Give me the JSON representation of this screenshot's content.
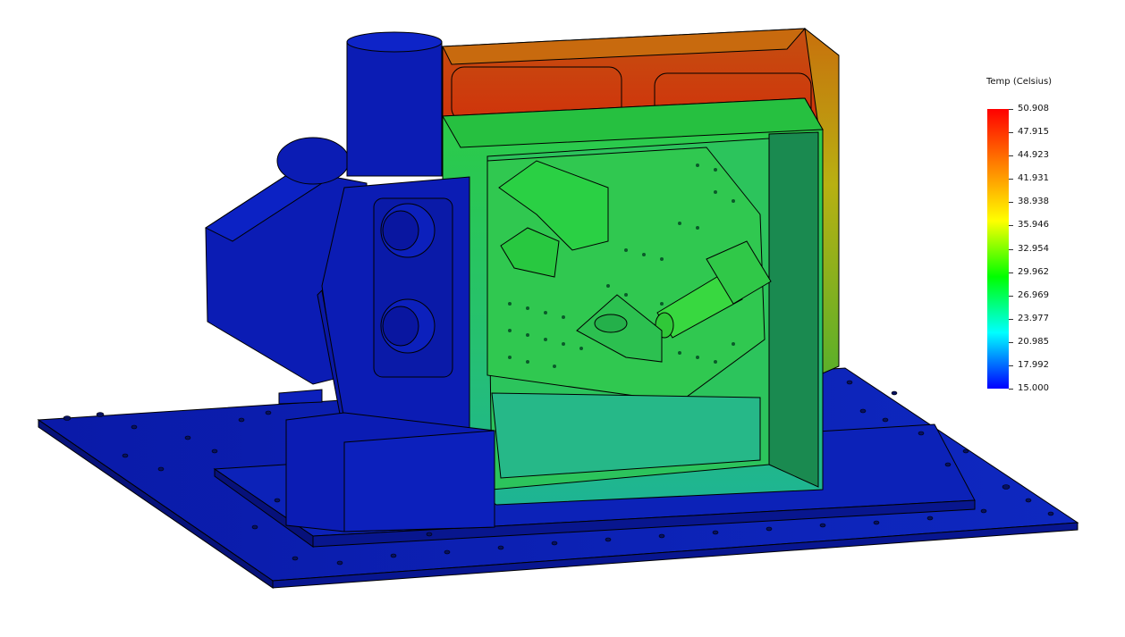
{
  "legend": {
    "title": "Temp (Celsius)",
    "ticks": [
      "50.908",
      "47.915",
      "44.923",
      "41.931",
      "38.938",
      "35.946",
      "32.954",
      "29.962",
      "26.969",
      "23.977",
      "20.985",
      "17.992",
      "15.000"
    ],
    "min": 15.0,
    "max": 50.908,
    "colormap": [
      "#ff0000",
      "#ff8000",
      "#ffff00",
      "#00ff00",
      "#00ffff",
      "#0000ff"
    ]
  },
  "colors": {
    "base_plate": "#0a1ca8",
    "enclosure_hot": "#d42a0a",
    "enclosure_warm": "#c8a010",
    "panel_green": "#2ac850",
    "panel_teal": "#20b88a",
    "cold_parts": "#0b1cb4"
  }
}
